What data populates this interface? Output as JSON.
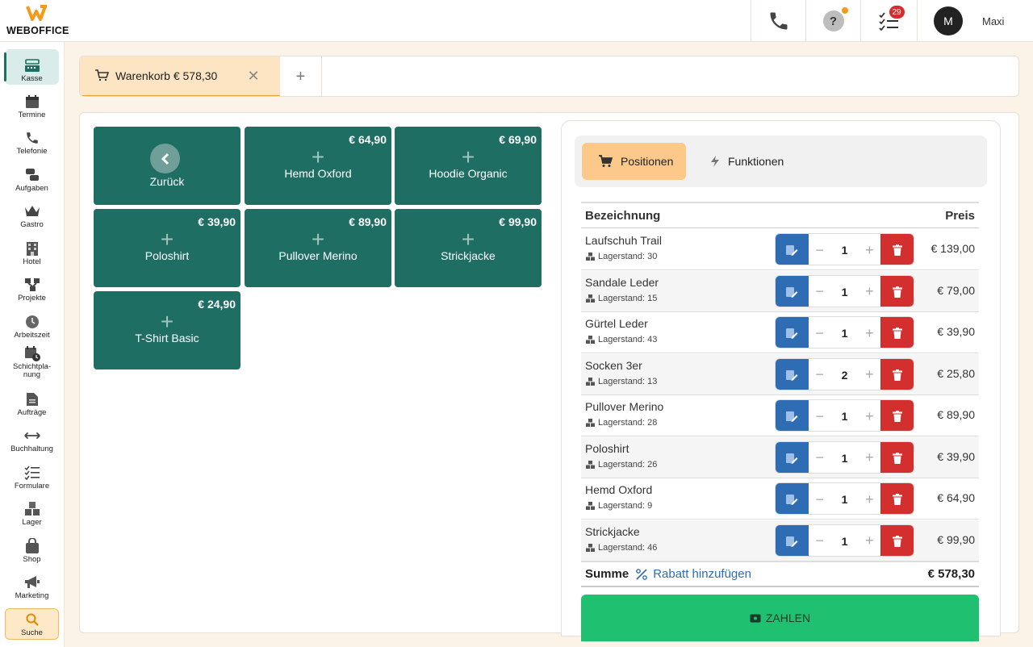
{
  "brand": {
    "name": "WEBOFFICE",
    "accent": "#f29a1a"
  },
  "header": {
    "tasks_badge": "29",
    "user_initial": "M",
    "user_name": "Maxi",
    "help_label": "?"
  },
  "sidebar": {
    "items": [
      {
        "label": "Kasse",
        "icon": "cash-register-icon",
        "active": true
      },
      {
        "label": "Termine",
        "icon": "calendar-icon"
      },
      {
        "label": "Telefonie",
        "icon": "phone-icon"
      },
      {
        "label": "Aufgaben",
        "icon": "chat-tasks-icon"
      },
      {
        "label": "Gastro",
        "icon": "crown-icon"
      },
      {
        "label": "Hotel",
        "icon": "building-icon"
      },
      {
        "label": "Projekte",
        "icon": "project-nodes-icon"
      },
      {
        "label": "Arbeitszeit",
        "icon": "clock-icon"
      },
      {
        "label": "Schichtpla-nung",
        "icon": "calendar-clock-icon"
      },
      {
        "label": "Aufträge",
        "icon": "document-icon"
      },
      {
        "label": "Buchhaltung",
        "icon": "arrows-left-right-icon"
      },
      {
        "label": "Formulare",
        "icon": "checklist-icon"
      },
      {
        "label": "Lager",
        "icon": "boxes-icon"
      },
      {
        "label": "Shop",
        "icon": "shopping-bag-icon"
      },
      {
        "label": "Marketing",
        "icon": "megaphone-icon"
      },
      {
        "label": "Suche",
        "icon": "search-icon"
      }
    ]
  },
  "tabs": {
    "cart_label": "Warenkorb € 578,30",
    "close_symbol": "✕",
    "add_symbol": "+"
  },
  "products": {
    "back_label": "Zurück",
    "items": [
      {
        "name": "Hemd Oxford",
        "price": "€ 64,90"
      },
      {
        "name": "Hoodie Organic",
        "price": "€ 69,90"
      },
      {
        "name": "Poloshirt",
        "price": "€ 39,90"
      },
      {
        "name": "Pullover Merino",
        "price": "€ 89,90"
      },
      {
        "name": "Strickjacke",
        "price": "€ 99,90"
      },
      {
        "name": "T-Shirt Basic",
        "price": "€ 24,90"
      }
    ]
  },
  "cart": {
    "segments": {
      "positions": "Positionen",
      "functions": "Funktionen"
    },
    "columns": {
      "name": "Bezeichnung",
      "price": "Preis"
    },
    "stock_prefix": "Lagerstand:",
    "rows": [
      {
        "name": "Laufschuh Trail",
        "stock": "Lagerstand: 30",
        "qty": "1",
        "price": "€ 139,00"
      },
      {
        "name": "Sandale Leder",
        "stock": "Lagerstand: 15",
        "qty": "1",
        "price": "€ 79,00"
      },
      {
        "name": "Gürtel Leder",
        "stock": "Lagerstand: 43",
        "qty": "1",
        "price": "€ 39,90"
      },
      {
        "name": "Socken 3er",
        "stock": "Lagerstand: 13",
        "qty": "2",
        "price": "€ 25,80"
      },
      {
        "name": "Pullover Merino",
        "stock": "Lagerstand: 28",
        "qty": "1",
        "price": "€ 89,90"
      },
      {
        "name": "Poloshirt",
        "stock": "Lagerstand: 26",
        "qty": "1",
        "price": "€ 39,90"
      },
      {
        "name": "Hemd Oxford",
        "stock": "Lagerstand: 9",
        "qty": "1",
        "price": "€ 64,90"
      },
      {
        "name": "Strickjacke",
        "stock": "Lagerstand: 46",
        "qty": "1",
        "price": "€ 99,90"
      }
    ],
    "sum_label": "Summe",
    "discount_label": "Rabatt hinzufügen",
    "sum_value": "€ 578,30",
    "pay_label": "ZAHLEN",
    "minus_symbol": "−",
    "plus_symbol": "+"
  },
  "colors": {
    "product_tile": "#1f6e64",
    "edit_button": "#2e6db4",
    "delete_button": "#d32f2f",
    "pay_button": "#1fc06f",
    "active_segment": "#fcc98a"
  }
}
